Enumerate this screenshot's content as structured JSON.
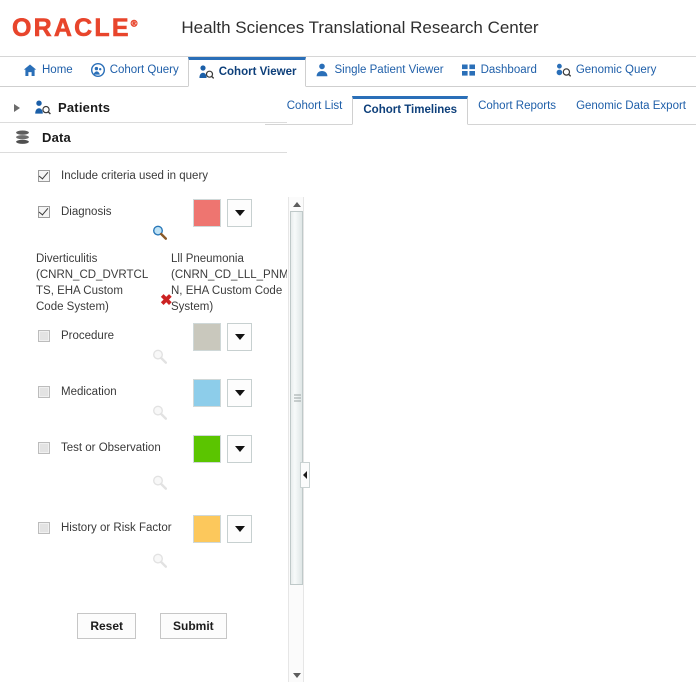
{
  "header": {
    "logo_text": "ORACLE",
    "logo_tm": "®",
    "app_title": "Health Sciences Translational Research Center",
    "logo_color": "#e8452c"
  },
  "main_nav": {
    "tabs": [
      {
        "label": "Home",
        "icon": "home-icon",
        "active": false
      },
      {
        "label": "Cohort Query",
        "icon": "cohort-query-icon",
        "active": false
      },
      {
        "label": "Cohort Viewer",
        "icon": "cohort-viewer-icon",
        "active": true
      },
      {
        "label": "Single Patient Viewer",
        "icon": "single-patient-icon",
        "active": false
      },
      {
        "label": "Dashboard",
        "icon": "dashboard-grid-icon",
        "active": false
      },
      {
        "label": "Genomic Query",
        "icon": "genomic-query-icon",
        "active": false
      }
    ]
  },
  "sub_nav": {
    "tabs": [
      {
        "label": "Cohort List",
        "active": false
      },
      {
        "label": "Cohort Timelines",
        "active": true
      },
      {
        "label": "Cohort Reports",
        "active": false
      },
      {
        "label": "Genomic Data Export",
        "active": false
      }
    ]
  },
  "left_panel": {
    "accordions": [
      {
        "label": "Patients",
        "icon": "patients-icon",
        "expanded": false,
        "has_twisty": true
      },
      {
        "label": "Data",
        "icon": "data-stack-icon",
        "expanded": true,
        "has_twisty": false
      }
    ],
    "include_criteria": {
      "label": "Include criteria used in query",
      "checked": true
    },
    "categories": [
      {
        "label": "Diagnosis",
        "checked": true,
        "enabled": true,
        "color": "#ee7570",
        "search_icon": "magnifier-icon"
      },
      {
        "label": "Procedure",
        "checked": false,
        "enabled": false,
        "color": "#c9c8bd",
        "search_icon": "magnifier-icon"
      },
      {
        "label": "Medication",
        "checked": false,
        "enabled": false,
        "color": "#8dcdea",
        "search_icon": "magnifier-icon"
      },
      {
        "label": "Test or Observation",
        "checked": false,
        "enabled": false,
        "color": "#5bc500",
        "search_icon": "magnifier-icon"
      },
      {
        "label": "History or Risk Factor",
        "checked": false,
        "enabled": false,
        "color": "#fcc85c",
        "search_icon": "magnifier-icon"
      }
    ],
    "diagnosis_criteria": [
      "Diverticulitis (CNRN_CD_DVRTCLTS, EHA Custom Code System)",
      "Lll Pneumonia (CNRN_CD_LLL_PNMN, EHA Custom Code System)"
    ],
    "delete_icon": "delete-x-icon"
  },
  "buttons": {
    "reset": "Reset",
    "submit": "Submit"
  },
  "scrollbar": {
    "up_arrow": "scroll-up-arrow",
    "down_arrow": "scroll-down-arrow"
  },
  "collapse": {
    "icon": "collapse-left-chevron"
  }
}
